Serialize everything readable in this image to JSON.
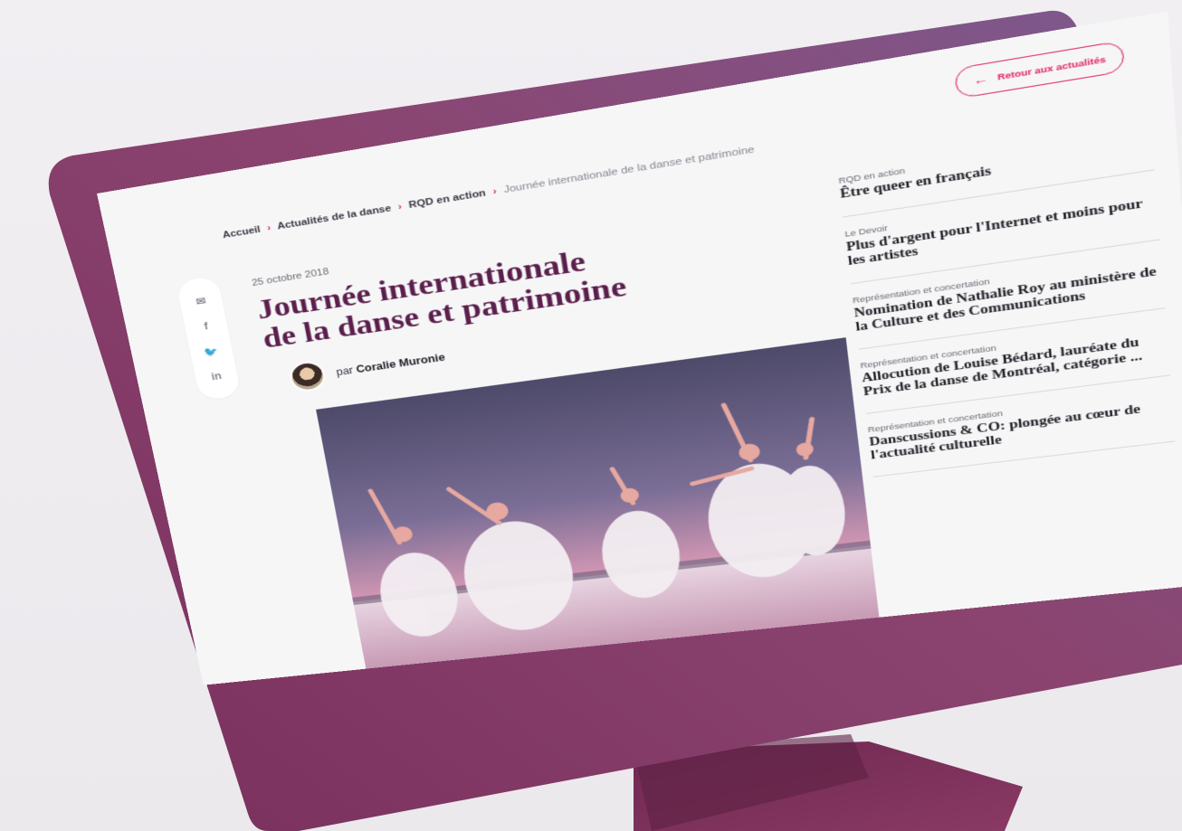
{
  "breadcrumb": {
    "items": [
      "Accueil",
      "Actualités de la danse",
      "RQD en action"
    ],
    "separator": "›",
    "current": "Journée internationale de la danse et patrimoine"
  },
  "back_button": {
    "label": "Retour aux actualités",
    "icon": "arrow-left-icon"
  },
  "article": {
    "date": "25 octobre 2018",
    "title_line1": "Journée internationale",
    "title_line2": "de la danse et patrimoine",
    "author_prefix": "par",
    "author_name": "Coralie Muronie"
  },
  "share": {
    "email_glyph": "✉",
    "facebook_glyph": "f",
    "twitter_glyph": "🐦",
    "linkedin_glyph": "in"
  },
  "related": [
    {
      "category": "RQD en action",
      "title": "Être queer en français"
    },
    {
      "category": "Le Devoir",
      "title": "Plus d'argent pour l'Internet et moins pour les artistes"
    },
    {
      "category": "Représentation et concertation",
      "title": "Nomination de Nathalie Roy au ministère de la Culture et des Communications"
    },
    {
      "category": "Représentation et concertation",
      "title": "Allocution de Louise Bédard, lauréate du Prix de la danse de Montréal, catégorie ..."
    },
    {
      "category": "Représentation et concertation",
      "title": "Danscussions & CO: plongée au cœur de l'actualité culturelle"
    }
  ],
  "colors": {
    "accent": "#e0245e",
    "title": "#5b1f4d",
    "monitor": "#8a3f6e"
  }
}
